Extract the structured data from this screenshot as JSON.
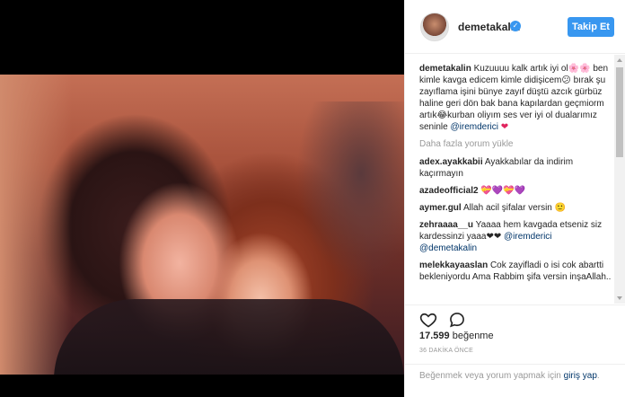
{
  "post": {
    "username": "demetakalin",
    "follow_label": "Takip Et",
    "caption_user": "demetakalin",
    "caption_text": "Kuzuuuu kalk artık iyi ol🌸🌸 ben kimle kavga edicem kimle didişicem😕 bırak şu zayıflama işini bünye zayıf düştü azcık gürbüz haline geri dön bak bana kapılardan geçmiorm artık😂kurban oliyım ses ver iyi ol dualarımız seninle",
    "caption_mention": "@iremderici",
    "caption_tail": "❤",
    "load_more": "Daha fazla yorum yükle",
    "comments": [
      {
        "user": "adex.ayakkabii",
        "text": "Ayakkabılar da indirim kaçırmayın"
      },
      {
        "user": "azadeofficial2",
        "text": "💝💜💝💜"
      },
      {
        "user": "aymer.gul",
        "text": "Allah acil şifalar versin 🙂"
      },
      {
        "user": "zehraaaa__u",
        "text": "Yaaaa hem kavgada etseniz siz kardessinzi yaaa❤❤",
        "mentions": [
          "@iremderici",
          "@demetakalin"
        ]
      },
      {
        "user": "melekkayaaslan",
        "text": "Cok zayifladi o isi cok abartti bekleniyordu Ama Rabbim şifa versin inşaAllah.."
      }
    ],
    "likes_count": "17.599",
    "likes_label": "beğenme",
    "time_ago": "36 DAKİKA ÖNCE",
    "login_prompt": "Beğenmek veya yorum yapmak için",
    "login_link": "giriş yap",
    "login_end": "."
  },
  "icons": {
    "heart": "heart-icon",
    "comment": "comment-icon",
    "verified": "verified-badge-icon"
  },
  "colors": {
    "accent": "#3897f0",
    "link": "#003569",
    "muted": "#999999"
  }
}
